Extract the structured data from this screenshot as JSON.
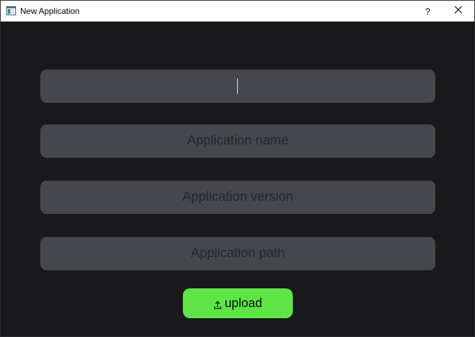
{
  "window": {
    "title": "New Application",
    "help_label": "?"
  },
  "icons": {
    "app": "window-app-icon",
    "close": "close-icon",
    "upload": "upload-icon"
  },
  "form": {
    "field1": {
      "value": "",
      "placeholder": ""
    },
    "name": {
      "value": "",
      "placeholder": "Application name"
    },
    "version": {
      "value": "",
      "placeholder": "Application version"
    },
    "path": {
      "value": "",
      "placeholder": "Application path"
    }
  },
  "actions": {
    "upload_label": "upload"
  },
  "colors": {
    "background": "#19191b",
    "field": "#46474c",
    "placeholder": "#27272a",
    "accent": "#5ce545"
  }
}
